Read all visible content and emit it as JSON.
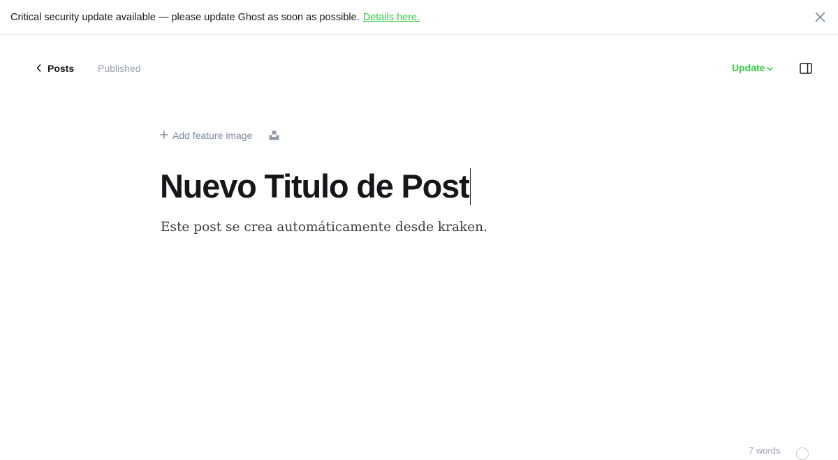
{
  "banner": {
    "message": "Critical security update available — please update Ghost as soon as possible.",
    "link_label": "Details here.",
    "close_icon": "close-icon"
  },
  "header": {
    "back_label": "Posts",
    "status": "Published",
    "update_label": "Update",
    "panel_icon": "sidebar-panel-icon"
  },
  "editor": {
    "add_feature_label": "Add feature image",
    "title": "Nuevo Titulo de Post",
    "body": "Este post se crea automáticamente desde kraken."
  },
  "footer": {
    "word_count": "7 words"
  },
  "colors": {
    "accent": "#30cf43",
    "muted": "#99a1ab",
    "text": "#15171a"
  }
}
